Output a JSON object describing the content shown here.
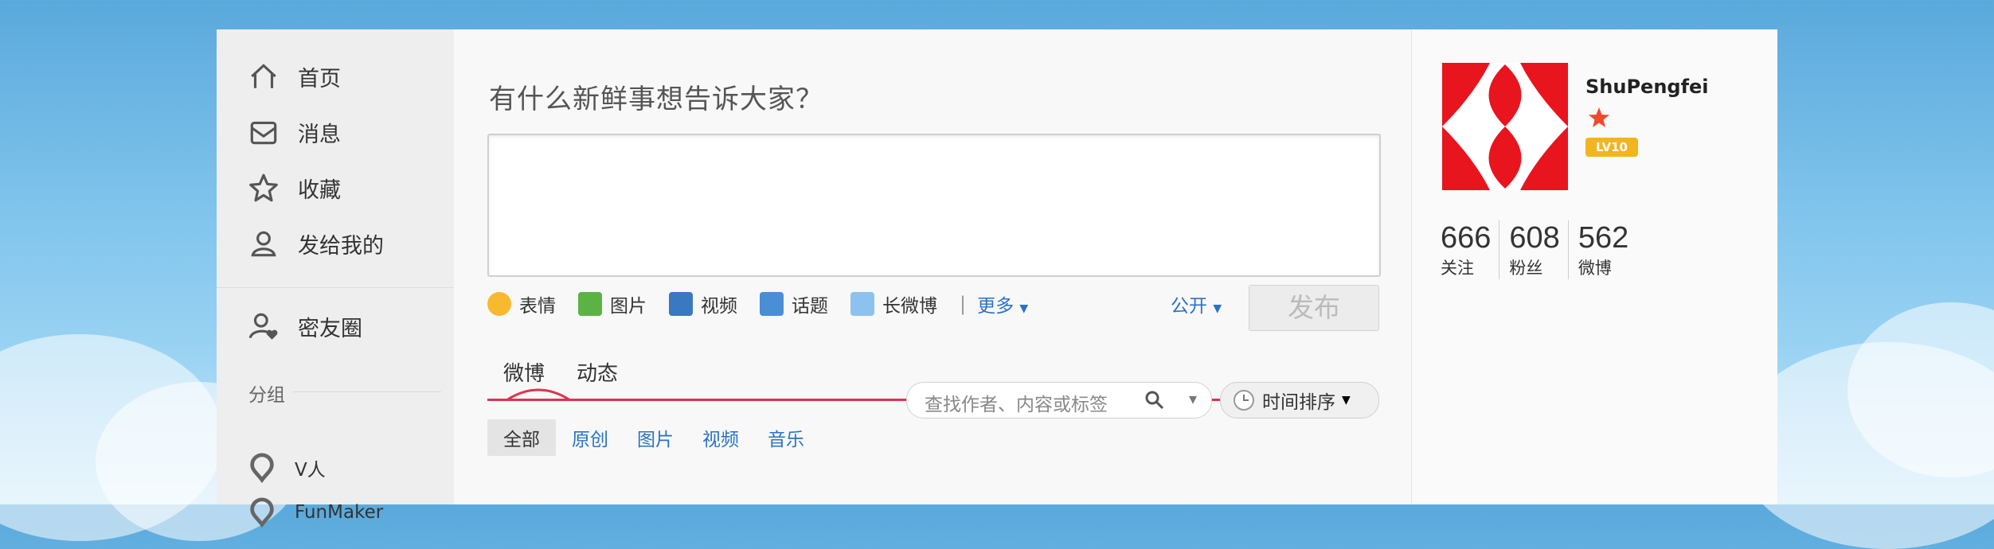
{
  "nav": {
    "items": [
      {
        "label": "首页",
        "icon": "home-icon"
      },
      {
        "label": "消息",
        "icon": "message-icon"
      },
      {
        "label": "收藏",
        "icon": "star-icon"
      },
      {
        "label": "发给我的",
        "icon": "user-icon"
      }
    ],
    "friends_circle": {
      "label": "密友圈",
      "icon": "friends-circle-icon"
    },
    "group_title": "分组",
    "groups": [
      {
        "label": "V人",
        "icon": "group-pin-icon"
      },
      {
        "label": "FunMaker",
        "icon": "group-pin-icon"
      }
    ]
  },
  "composer": {
    "prompt": "有什么新鲜事想告诉大家？",
    "editor_value": "",
    "tools": [
      {
        "label": "表情",
        "icon": "emoticon-icon"
      },
      {
        "label": "图片",
        "icon": "image-icon"
      },
      {
        "label": "视频",
        "icon": "video-icon"
      },
      {
        "label": "话题",
        "icon": "topic-icon"
      },
      {
        "label": "长微博",
        "icon": "long-weibo-icon"
      }
    ],
    "more_label": "更多",
    "visibility_label": "公开",
    "publish_label": "发布"
  },
  "feed": {
    "tabs": [
      {
        "label": "微博"
      },
      {
        "label": "动态"
      }
    ],
    "search_placeholder": "查找作者、内容或标签",
    "sort_label": "时间排序",
    "filters": [
      {
        "label": "全部"
      },
      {
        "label": "原创"
      },
      {
        "label": "图片"
      },
      {
        "label": "视频"
      },
      {
        "label": "音乐"
      }
    ]
  },
  "profile": {
    "username": "ShuPengfei",
    "level_badge": "LV10",
    "stats": [
      {
        "value": "666",
        "label": "关注"
      },
      {
        "value": "608",
        "label": "粉丝"
      },
      {
        "value": "562",
        "label": "微博"
      }
    ]
  },
  "colors": {
    "accent": "#2a72c6",
    "tab_line": "#e0324b",
    "avatar_red": "#e8141e"
  }
}
